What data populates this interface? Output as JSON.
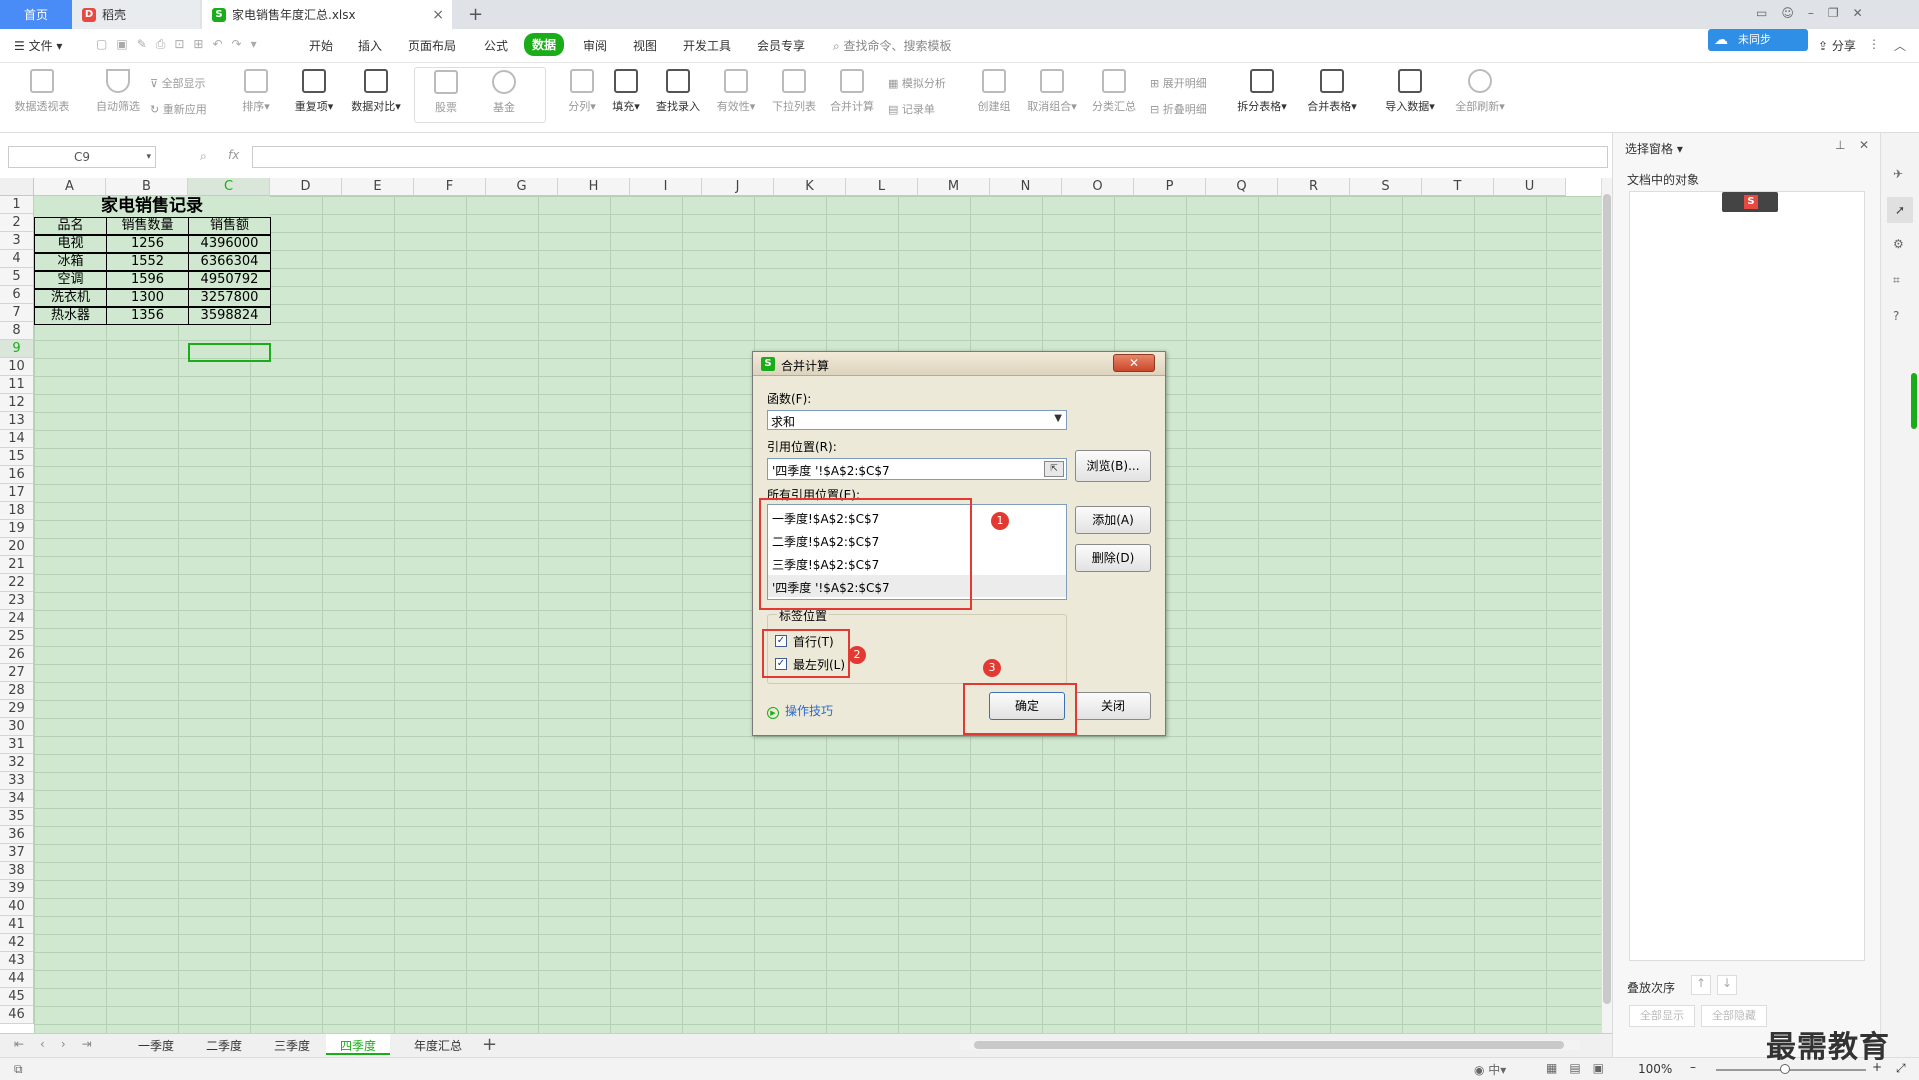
{
  "tabs": {
    "home": "首页",
    "wps": "稻壳",
    "file": "家电销售年度汇总.xlsx",
    "file_close": "×",
    "new": "+"
  },
  "menu": {
    "file": "文件",
    "items": [
      "开始",
      "插入",
      "页面布局",
      "公式",
      "数据",
      "审阅",
      "视图",
      "开发工具",
      "会员专享"
    ],
    "active": "数据",
    "search": "查找命令、搜索模板",
    "share": "分享",
    "cloud": "未同步"
  },
  "ribbon": {
    "pivot": "数据透视表",
    "filter": "自动筛选",
    "showall": "全部显示",
    "reapply": "重新应用",
    "sort": "排序",
    "dup": "重复项",
    "compare": "数据对比",
    "stock": "股票",
    "fund": "基金",
    "split": "分列",
    "fill": "填充",
    "lookup": "查找录入",
    "valid": "有效性",
    "dropdown": "下拉列表",
    "consolidate": "合并计算",
    "whatif": "模拟分析",
    "record": "记录单",
    "group": "创建组",
    "ungroup": "取消组合",
    "subtotal": "分类汇总",
    "expand": "展开明细",
    "collapse": "折叠明细",
    "splittable": "拆分表格",
    "mergetable": "合并表格",
    "import": "导入数据",
    "refresh": "全部刷新"
  },
  "formula": {
    "namebox": "C9",
    "fx": "fx"
  },
  "grid": {
    "cols": [
      "A",
      "B",
      "C",
      "D",
      "E",
      "F",
      "G",
      "H",
      "I",
      "J",
      "K",
      "L",
      "M",
      "N",
      "O",
      "P",
      "Q",
      "R",
      "S",
      "T",
      "U"
    ],
    "rows": [
      "1",
      "2",
      "3",
      "4",
      "5",
      "6",
      "7",
      "8",
      "9",
      "10",
      "11",
      "12",
      "13",
      "14",
      "15",
      "16",
      "17",
      "18",
      "19",
      "20",
      "21",
      "22",
      "23",
      "24",
      "25",
      "26",
      "27",
      "28",
      "29",
      "30",
      "31",
      "32",
      "33",
      "34",
      "35",
      "36",
      "37",
      "38",
      "39",
      "40",
      "41",
      "42",
      "43",
      "44",
      "45",
      "46"
    ],
    "title": "家电销售记录",
    "headers": [
      "品名",
      "销售数量",
      "销售额"
    ],
    "data": [
      [
        "电视",
        "1256",
        "4396000"
      ],
      [
        "冰箱",
        "1552",
        "6366304"
      ],
      [
        "空调",
        "1596",
        "4950792"
      ],
      [
        "洗衣机",
        "1300",
        "3257800"
      ],
      [
        "热水器",
        "1356",
        "3598824"
      ]
    ]
  },
  "sheets": [
    "一季度",
    "二季度",
    "三季度",
    "四季度",
    "年度汇总"
  ],
  "active_sheet": "四季度",
  "status": {
    "zoom": "100%"
  },
  "panel": {
    "title": "选择窗格",
    "objects": "文档中的对象",
    "order": "叠放次序",
    "showall": "全部显示",
    "hideall": "全部隐藏"
  },
  "dialog": {
    "title": "合并计算",
    "func_label": "函数(F):",
    "func_value": "求和",
    "ref_label": "引用位置(R):",
    "ref_value": "'四季度 '!$A$2:$C$7",
    "browse": "浏览(B)...",
    "all_label": "所有引用位置(E):",
    "refs": [
      "一季度!$A$2:$C$7",
      "二季度!$A$2:$C$7",
      "三季度!$A$2:$C$7",
      "'四季度 '!$A$2:$C$7"
    ],
    "add": "添加(A)",
    "delete": "删除(D)",
    "label_group": "标签位置",
    "first_row": "首行(T)",
    "left_col": "最左列(L)",
    "tips": "操作技巧",
    "ok": "确定",
    "close": "关闭",
    "badges": [
      "1",
      "2",
      "3"
    ]
  },
  "watermark": "最需教育",
  "colors": {
    "active_tab": "#1aad19",
    "grid_bg": "#cfe8cf",
    "highlight": "#e23a32"
  }
}
